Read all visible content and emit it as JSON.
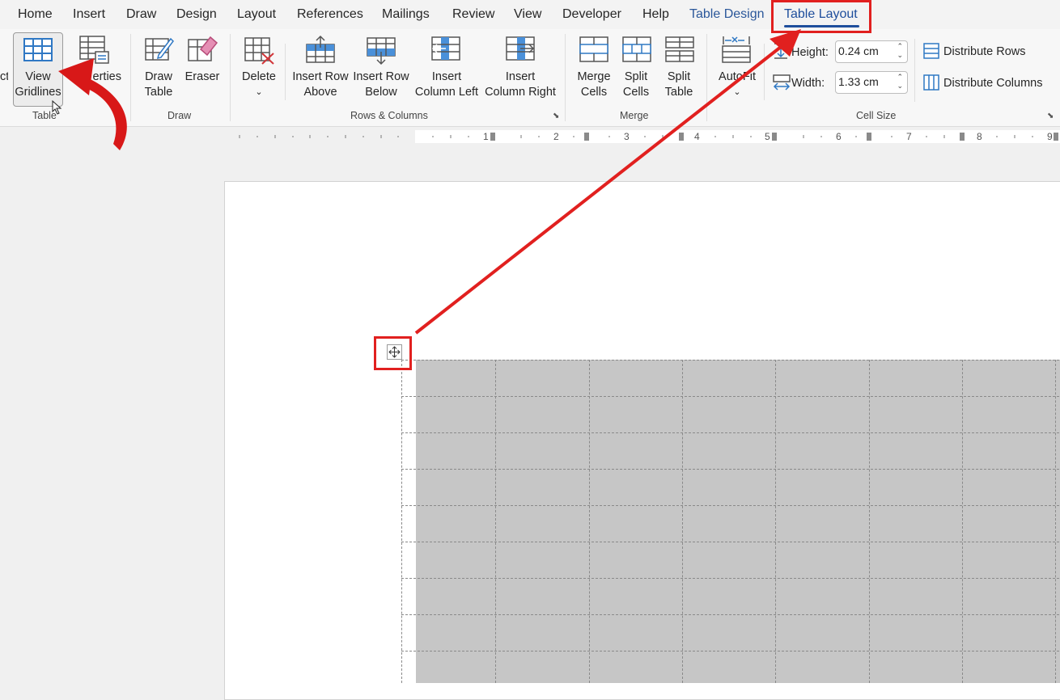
{
  "tabs": [
    {
      "label": "Home",
      "kind": "normal"
    },
    {
      "label": "Insert",
      "kind": "normal"
    },
    {
      "label": "Draw",
      "kind": "normal"
    },
    {
      "label": "Design",
      "kind": "normal"
    },
    {
      "label": "Layout",
      "kind": "normal"
    },
    {
      "label": "References",
      "kind": "normal"
    },
    {
      "label": "Mailings",
      "kind": "normal"
    },
    {
      "label": "Review",
      "kind": "normal"
    },
    {
      "label": "View",
      "kind": "normal"
    },
    {
      "label": "Developer",
      "kind": "normal"
    },
    {
      "label": "Help",
      "kind": "normal"
    },
    {
      "label": "Table Design",
      "kind": "contextual"
    },
    {
      "label": "Table Layout",
      "kind": "active"
    }
  ],
  "ribbon": {
    "table_group": {
      "label": "Table",
      "select_partial": "ct",
      "view_gridlines_line1": "View",
      "view_gridlines_line2": "Gridlines",
      "properties_partial": "erties"
    },
    "draw_group": {
      "label": "Draw",
      "draw_table_line1": "Draw",
      "draw_table_line2": "Table",
      "eraser": "Eraser"
    },
    "rows_columns_group": {
      "label": "Rows & Columns",
      "delete": "Delete",
      "insert_above_line1": "Insert Row",
      "insert_above_line2": "Above",
      "insert_below_line1": "Insert Row",
      "insert_below_line2": "Below",
      "insert_left_line1": "Insert",
      "insert_left_line2": "Column Left",
      "insert_right_line1": "Insert",
      "insert_right_line2": "Column Right"
    },
    "merge_group": {
      "label": "Merge",
      "merge_cells_line1": "Merge",
      "merge_cells_line2": "Cells",
      "split_cells_line1": "Split",
      "split_cells_line2": "Cells",
      "split_table_line1": "Split",
      "split_table_line2": "Table"
    },
    "cell_size_group": {
      "label": "Cell Size",
      "autofit": "AutoFit",
      "height_label": "Height:",
      "height_value": "0.24 cm",
      "width_label": "Width:",
      "width_value": "1.33 cm",
      "distribute_rows": "Distribute Rows",
      "distribute_columns": "Distribute Columns"
    }
  },
  "ruler": {
    "numbers": [
      "1",
      "2",
      "3",
      "4",
      "5",
      "6",
      "7",
      "8",
      "9"
    ]
  },
  "icons": {
    "move_handle": "move-arrows-icon",
    "annotation_color": "#e1201f",
    "accent_blue": "#1e4e9c",
    "table_shading": "#c6c6c6"
  }
}
